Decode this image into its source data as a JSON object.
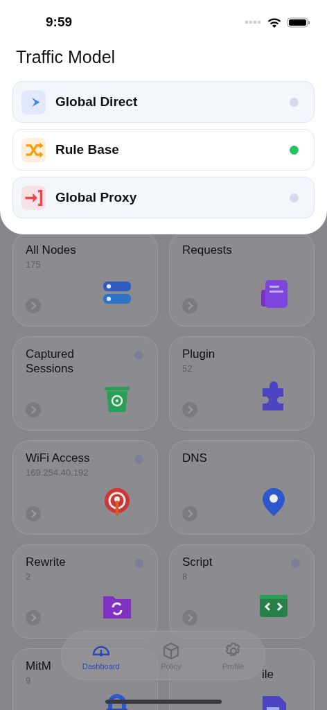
{
  "status_bar": {
    "time": "9:59"
  },
  "sheet": {
    "title": "Traffic Model",
    "modes": [
      {
        "label": "Global Direct",
        "selected": false
      },
      {
        "label": "Rule Base",
        "selected": true
      },
      {
        "label": "Global Proxy",
        "selected": false
      }
    ]
  },
  "cards": [
    {
      "kind": "full",
      "title": "All Nodes",
      "count": "175"
    },
    {
      "kind": "full",
      "title": "Requests"
    },
    {
      "kind": "full",
      "title": "Captured Sessions",
      "on": false
    },
    {
      "kind": "full",
      "title": "Plugin",
      "count": "52"
    },
    {
      "kind": "full",
      "title": "WiFi Access",
      "count": "169.254.40.192",
      "on": false
    },
    {
      "kind": "full",
      "title": "DNS"
    },
    {
      "kind": "full",
      "title": "Rewrite",
      "count": "2",
      "on": false
    },
    {
      "kind": "full",
      "title": "Script",
      "count": "8",
      "on": false
    },
    {
      "kind": "full",
      "title": "MitM",
      "count": "9"
    },
    {
      "kind": "covered",
      "title": "ile"
    }
  ],
  "tab_bar": [
    {
      "label": "Dashboard",
      "selected": true
    },
    {
      "label": "Policy",
      "selected": false
    },
    {
      "label": "Profile",
      "selected": false
    }
  ]
}
